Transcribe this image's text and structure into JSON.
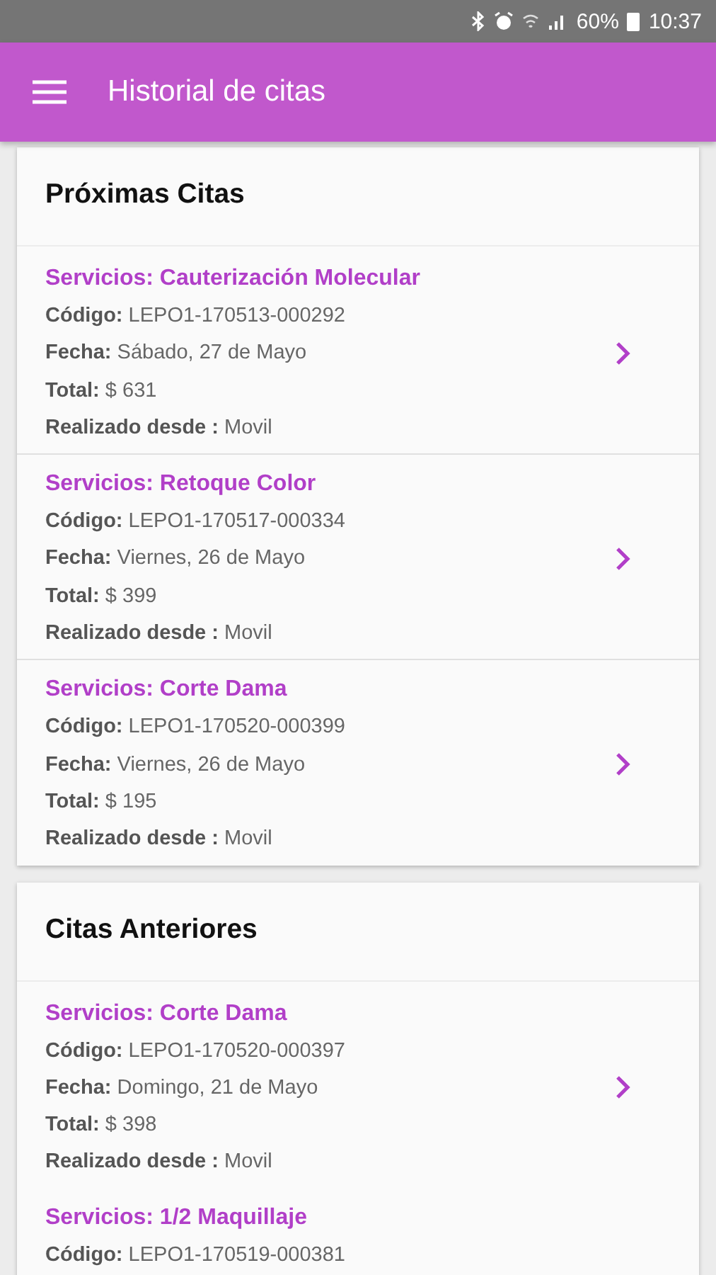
{
  "status_bar": {
    "battery": "60%",
    "time": "10:37"
  },
  "app_bar": {
    "title": "Historial de citas"
  },
  "sections": [
    {
      "title": "Próximas Citas",
      "items": [
        {
          "service": "Servicios: Cauterización Molecular",
          "lines": [
            "**Código:** LEPO1-170513-000292",
            "**Fecha:** Sábado, 27 de Mayo",
            "**Total:** $ 631",
            "**Realizado desde :** Movil"
          ],
          "arrow": true
        },
        {
          "service": "Servicios: Retoque Color",
          "lines": [
            "**Código:** LEPO1-170517-000334",
            "**Fecha:** Viernes, 26 de Mayo",
            "**Total:** $ 399",
            "**Realizado desde :** Movil"
          ],
          "arrow": true
        },
        {
          "service": "Servicios: Corte Dama",
          "lines": [
            "**Código:** LEPO1-170520-000399",
            "**Fecha:** Viernes, 26 de Mayo",
            "**Total:** $ 195",
            "**Realizado desde :** Movil"
          ],
          "arrow": true
        }
      ]
    },
    {
      "title": "Citas Anteriores",
      "items": [
        {
          "service": "Servicios: Corte Dama",
          "lines": [
            "**Código:** LEPO1-170520-000397",
            "**Fecha:** Domingo, 21 de Mayo",
            "**Total:** $ 398",
            "**Realizado desde :** Movil"
          ],
          "arrow": true
        },
        {
          "service": "Servicios: 1/2 Maquillaje",
          "lines": [
            "**Código:** LEPO1-170519-000381"
          ],
          "arrow": false
        }
      ]
    }
  ]
}
